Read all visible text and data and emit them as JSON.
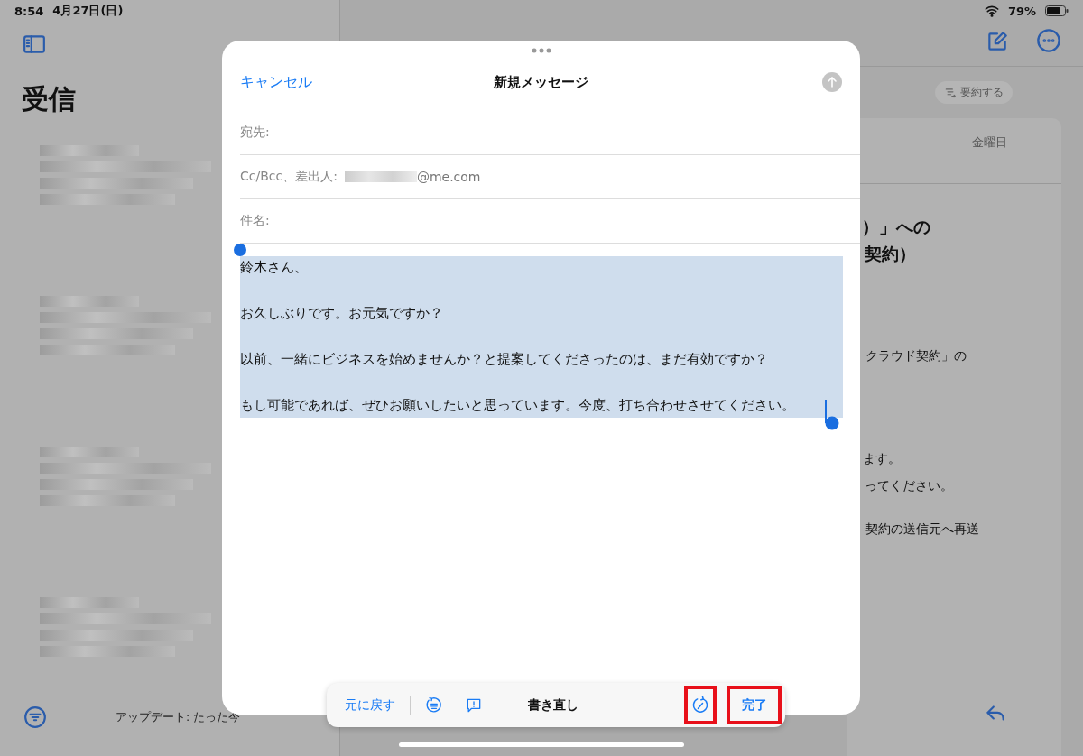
{
  "status_bar": {
    "time": "8:54",
    "date": "4月27日(日)",
    "battery": "79%"
  },
  "sidebar": {
    "title": "受信",
    "footer": "アップデート: たった今"
  },
  "reader": {
    "summarize": "要約する",
    "date": "金曜日",
    "heading": [
      "）」への",
      "契約）"
    ],
    "lines": [
      "クラウド契約」の",
      "ます。",
      "ってください。",
      "契約の送信元へ再送"
    ]
  },
  "compose": {
    "cancel": "キャンセル",
    "title": "新規メッセージ",
    "send_enabled": false,
    "fields": [
      {
        "label": "宛先:"
      },
      {
        "label": "Cc/Bcc、差出人:",
        "value": "@me.com"
      },
      {
        "label": "件名:"
      }
    ],
    "body": {
      "selected": true,
      "paragraphs": [
        "鈴木さん、",
        "お久しぶりです。お元気ですか？",
        "以前、一緒にビジネスを始めませんか？と提案してくださったのは、まだ有効ですか？",
        "もし可能であれば、ぜひお願いしたいと思っています。今度、打ち合わせさせてください。"
      ]
    }
  },
  "toolbar": {
    "undo": "元に戻す",
    "title": "書き直し",
    "rewrite": {
      "highlighted": true
    },
    "done": {
      "label": "完了",
      "highlighted": true
    }
  }
}
